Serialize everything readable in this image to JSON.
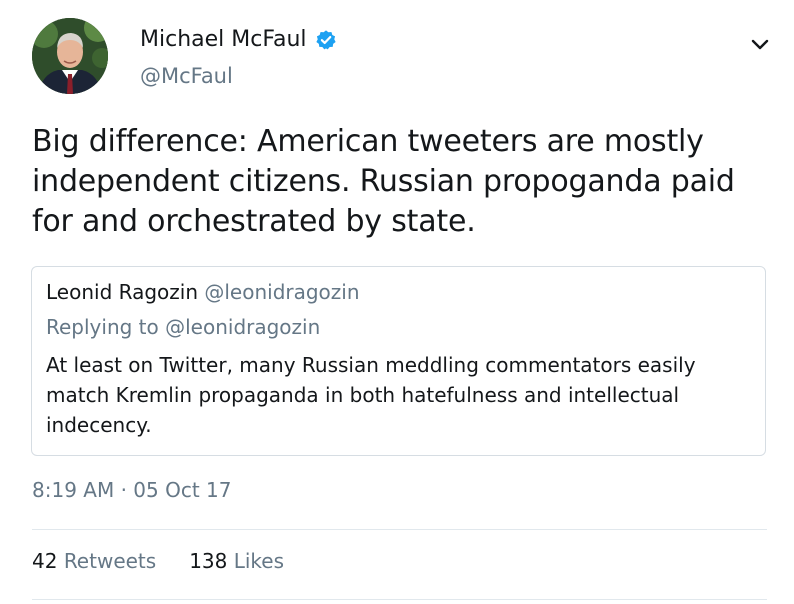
{
  "author": {
    "display_name": "Michael McFaul",
    "handle": "@McFaul",
    "avatar_icon": "profile-photo",
    "verified_icon": "verified-badge-icon",
    "verified_color": "#1da1f2"
  },
  "menu": {
    "icon": "chevron-down-icon"
  },
  "tweet": {
    "text": "Big difference: American tweeters are mostly independent citizens. Russian propoganda paid for and orchestrated by state."
  },
  "quoted_tweet": {
    "display_name": "Leonid Ragozin",
    "handle": "@leonidragozin",
    "reply_context": "Replying to @leonidragozin",
    "text": "At least on Twitter, many Russian meddling commentators easily match Kremlin propaganda in both hatefulness and intellectual indecency."
  },
  "meta": {
    "timestamp": "8:19 AM · 05 Oct 17"
  },
  "stats": {
    "retweets_count": "42",
    "retweets_label": "Retweets",
    "likes_count": "138",
    "likes_label": "Likes"
  },
  "colors": {
    "text_primary": "#14171a",
    "text_secondary": "#657786",
    "border": "#d6dde3"
  }
}
